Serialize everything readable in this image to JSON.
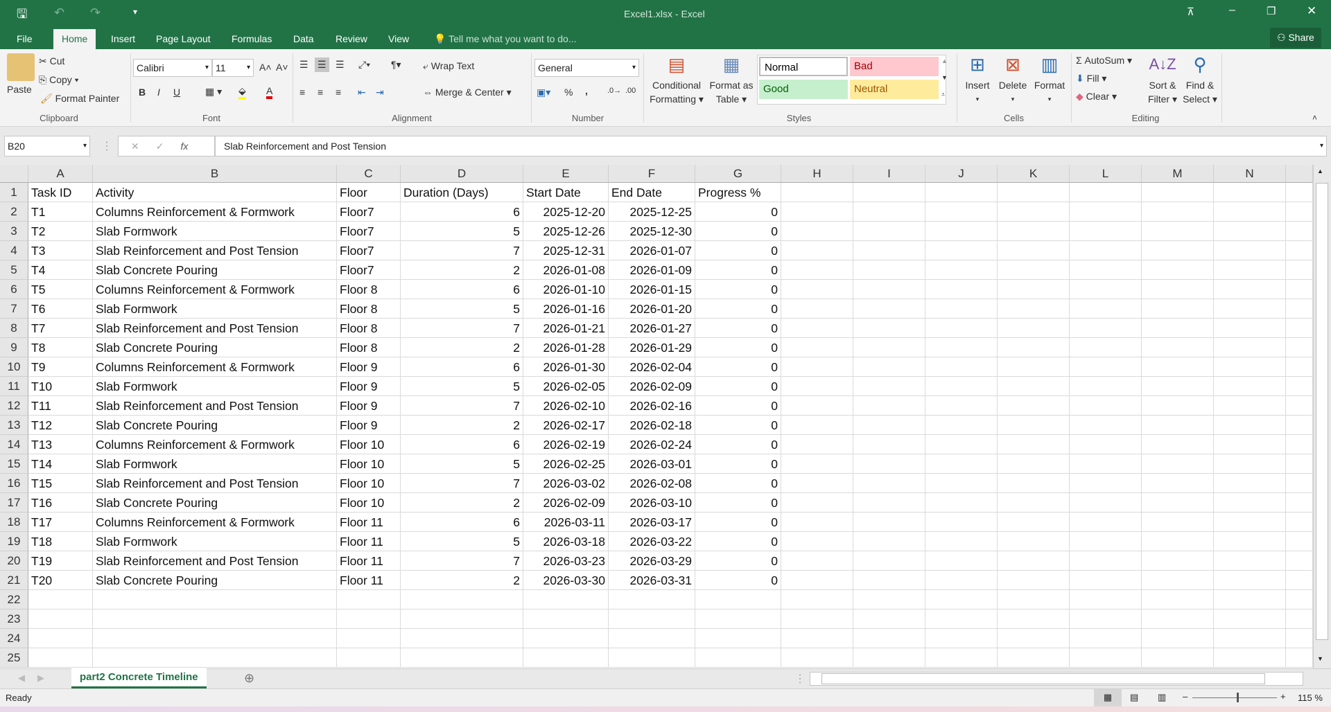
{
  "window": {
    "title": "Excel1.xlsx - Excel",
    "share": "Share"
  },
  "tabs": [
    "File",
    "Home",
    "Insert",
    "Page Layout",
    "Formulas",
    "Data",
    "Review",
    "View"
  ],
  "tell_me": "Tell me what you want to do...",
  "ribbon": {
    "clipboard": {
      "paste": "Paste",
      "cut": "Cut",
      "copy": "Copy",
      "format_painter": "Format Painter",
      "label": "Clipboard"
    },
    "font": {
      "name": "Calibri",
      "size": "11",
      "label": "Font",
      "bold": "B",
      "italic": "I",
      "underline": "U"
    },
    "alignment": {
      "wrap_text": "Wrap Text",
      "merge_center": "Merge & Center",
      "label": "Alignment"
    },
    "number": {
      "format": "General",
      "label": "Number"
    },
    "styles": {
      "conditional": [
        "Conditional",
        "Formatting"
      ],
      "format_table": [
        "Format as",
        "Table"
      ],
      "normal": "Normal",
      "bad": "Bad",
      "good": "Good",
      "neutral": "Neutral",
      "label": "Styles"
    },
    "cells": {
      "insert": "Insert",
      "delete": "Delete",
      "format": "Format",
      "label": "Cells"
    },
    "editing": {
      "autosum": "AutoSum",
      "fill": "Fill",
      "clear": "Clear",
      "sort": [
        "Sort &",
        "Filter"
      ],
      "find": [
        "Find &",
        "Select"
      ],
      "label": "Editing"
    }
  },
  "formula_bar": {
    "name_box": "B20",
    "content": "Slab Reinforcement and Post Tension"
  },
  "columns": [
    "A",
    "B",
    "C",
    "D",
    "E",
    "F",
    "G",
    "H",
    "I",
    "J",
    "K",
    "L",
    "M",
    "N"
  ],
  "header": [
    "Task ID",
    "Activity",
    "Floor",
    "Duration (Days)",
    "Start Date",
    "End Date",
    "Progress %"
  ],
  "rows": [
    [
      "T1",
      "Columns Reinforcement & Formwork",
      "Floor7",
      "6",
      "2025-12-20",
      "2025-12-25",
      "0"
    ],
    [
      "T2",
      "Slab Formwork",
      "Floor7",
      "5",
      "2025-12-26",
      "2025-12-30",
      "0"
    ],
    [
      "T3",
      "Slab Reinforcement and Post Tension",
      "Floor7",
      "7",
      "2025-12-31",
      "2026-01-07",
      "0"
    ],
    [
      "T4",
      "Slab Concrete Pouring",
      "Floor7",
      "2",
      "2026-01-08",
      "2026-01-09",
      "0"
    ],
    [
      "T5",
      "Columns Reinforcement & Formwork",
      "Floor 8",
      "6",
      "2026-01-10",
      "2026-01-15",
      "0"
    ],
    [
      "T6",
      "Slab Formwork",
      "Floor 8",
      "5",
      "2026-01-16",
      "2026-01-20",
      "0"
    ],
    [
      "T7",
      "Slab Reinforcement and Post Tension",
      "Floor 8",
      "7",
      "2026-01-21",
      "2026-01-27",
      "0"
    ],
    [
      "T8",
      "Slab Concrete Pouring",
      "Floor 8",
      "2",
      "2026-01-28",
      "2026-01-29",
      "0"
    ],
    [
      "T9",
      "Columns Reinforcement & Formwork",
      "Floor 9",
      "6",
      "2026-01-30",
      "2026-02-04",
      "0"
    ],
    [
      "T10",
      "Slab Formwork",
      "Floor 9",
      "5",
      "2026-02-05",
      "2026-02-09",
      "0"
    ],
    [
      "T11",
      "Slab Reinforcement and Post Tension",
      "Floor 9",
      "7",
      "2026-02-10",
      "2026-02-16",
      "0"
    ],
    [
      "T12",
      "Slab Concrete Pouring",
      "Floor 9",
      "2",
      "2026-02-17",
      "2026-02-18",
      "0"
    ],
    [
      "T13",
      "Columns Reinforcement & Formwork",
      "Floor 10",
      "6",
      "2026-02-19",
      "2026-02-24",
      "0"
    ],
    [
      "T14",
      "Slab Formwork",
      "Floor 10",
      "5",
      "2026-02-25",
      "2026-03-01",
      "0"
    ],
    [
      "T15",
      "Slab Reinforcement and Post Tension",
      "Floor 10",
      "7",
      "2026-03-02",
      "2026-02-08",
      "0"
    ],
    [
      "T16",
      "Slab Concrete Pouring",
      "Floor 10",
      "2",
      "2026-02-09",
      "2026-03-10",
      "0"
    ],
    [
      "T17",
      "Columns Reinforcement & Formwork",
      "Floor 11",
      "6",
      "2026-03-11",
      "2026-03-17",
      "0"
    ],
    [
      "T18",
      "Slab Formwork",
      "Floor 11",
      "5",
      "2026-03-18",
      "2026-03-22",
      "0"
    ],
    [
      "T19",
      "Slab Reinforcement and Post Tension",
      "Floor 11",
      "7",
      "2026-03-23",
      "2026-03-29",
      "0"
    ],
    [
      "T20",
      "Slab Concrete Pouring",
      "Floor 11",
      "2",
      "2026-03-30",
      "2026-03-31",
      "0"
    ]
  ],
  "total_rows": 25,
  "sheet_tab": "part2 Concrete Timeline",
  "status": {
    "text": "Ready",
    "zoom": "115 %",
    "zoom_percent": 115
  }
}
